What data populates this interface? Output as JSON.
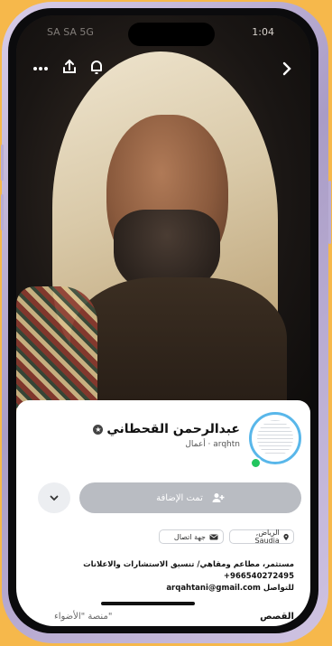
{
  "status": {
    "carrier": "SA SA 5G",
    "time": "1:04"
  },
  "top_icons": {
    "more": "more-icon",
    "share": "share-icon",
    "notify": "bell-icon",
    "next": "chevron-right-icon"
  },
  "profile": {
    "name": "عبدالرحمن القحطاني",
    "subline": "arqhtn · أعمال",
    "add_button": "تمت الإضافة",
    "location_chip": "الرياض, Saudia",
    "contact_chip": "جهة اتصال"
  },
  "bio": {
    "line1": "مستثمر، مطاعم ومقاهي/ تنسيق الاستشارات والاعلانات",
    "line2": "+966540272495",
    "line3": "للتواصل arqahtani@gmail.com"
  },
  "tabs": {
    "stories": "القصص",
    "platform": "منصة \"الأضواء\""
  },
  "colors": {
    "background": "#f6b84b",
    "ring": "#59b7ea",
    "online": "#22c55e",
    "button": "#b9bcc2"
  }
}
